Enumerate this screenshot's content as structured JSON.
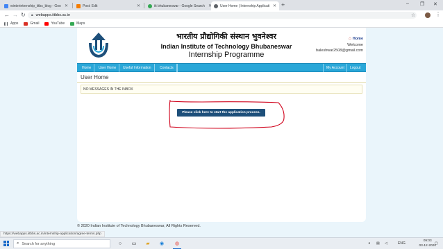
{
  "browser": {
    "tabs": [
      {
        "title": "winterinternship_iitbs_blog - Goo",
        "icon_color": "#4285f4",
        "active": false
      },
      {
        "title": "Post: Edit",
        "icon_color": "#f57c00",
        "active": false
      },
      {
        "title": "iit bhubaneswar - Google Search",
        "icon_color": "#34a853",
        "active": false
      },
      {
        "title": "User Home | Internship Applicati",
        "icon_color": "#5f6368",
        "active": true
      }
    ],
    "new_tab_symbol": "+",
    "window_controls": {
      "minimize": "–",
      "maximize": "❐",
      "close": "✕"
    },
    "url": "webapps.iitbbs.ac.in",
    "bookmarks": [
      {
        "label": "Apps",
        "icon_color": "#5f6368"
      },
      {
        "label": "Gmail",
        "icon_color": "#d93025"
      },
      {
        "label": "YouTube",
        "icon_color": "#ff0000"
      },
      {
        "label": "Maps",
        "icon_color": "#34a853"
      }
    ],
    "status_link": "https://webapps.iitbbs.ac.in/internship-application/agree-terms.php"
  },
  "site": {
    "title_hindi": "भारतीय प्रौद्योगिकी संस्थान भुवनेश्वर",
    "title_english": "Indian Institute of Technology Bhubaneswar",
    "subtitle": "Internship Programme",
    "home_link": "Home",
    "welcome": "Welcome",
    "email": "baleshwar2508@gmail.com",
    "nav_left": [
      "Home",
      "User Home",
      "Useful Information",
      "Contacts"
    ],
    "nav_right": [
      "My Account",
      "Logout"
    ],
    "page_heading": "User Home",
    "inbox_message": "NO MESSAGES IN THE INBOX",
    "apply_button": "Please click here to start the application process.",
    "footer": "© 2020 Indian Institute of Technology Bhubaneswar, All Rights Reserved.",
    "colors": {
      "nav": "#2aa7d8",
      "button": "#1d4f7a",
      "annotation": "#d0021b",
      "page_bg": "#eaf5fb"
    }
  },
  "taskbar": {
    "search_placeholder": "Search for anything",
    "language": "ENG",
    "time": "09:03",
    "date": "03-12-2020"
  }
}
